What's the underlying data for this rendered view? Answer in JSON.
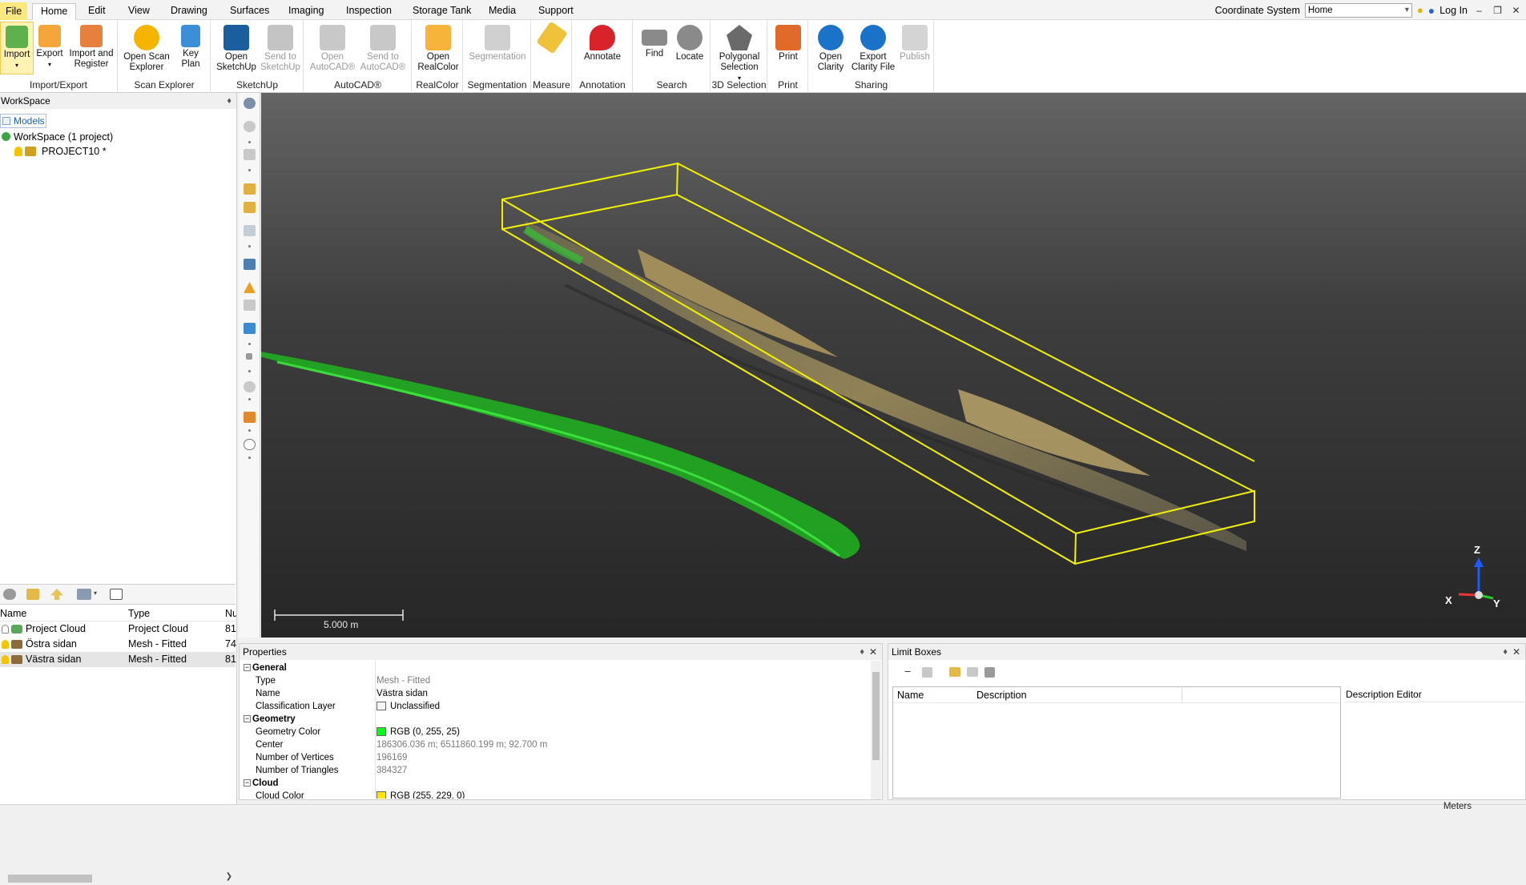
{
  "tabs": {
    "file": "File",
    "items": [
      "Home",
      "Edit",
      "View",
      "Drawing",
      "Surfaces",
      "Imaging",
      "Inspection",
      "Storage Tank",
      "Media",
      "Support"
    ]
  },
  "topright": {
    "coordinate_label": "Coordinate System",
    "coordinate_value": "Home",
    "login": "Log In"
  },
  "ribbon": {
    "groups": [
      {
        "name": "Import/Export",
        "buttons": [
          "Import",
          "Export",
          "Import and Register"
        ]
      },
      {
        "name": "Scan Explorer",
        "buttons": [
          "Open Scan Explorer",
          "Key Plan"
        ]
      },
      {
        "name": "SketchUp",
        "buttons": [
          "Open SketchUp",
          "Send to SketchUp"
        ]
      },
      {
        "name": "AutoCAD®",
        "buttons": [
          "Open AutoCAD®",
          "Send to AutoCAD®"
        ]
      },
      {
        "name": "RealColor",
        "buttons": [
          "Open RealColor"
        ]
      },
      {
        "name": "Segmentation",
        "buttons": [
          "Segmentation"
        ]
      },
      {
        "name": "Measure",
        "buttons": []
      },
      {
        "name": "Annotation",
        "buttons": [
          "Annotate"
        ]
      },
      {
        "name": "Search",
        "buttons": [
          "Find",
          "Locate"
        ]
      },
      {
        "name": "3D Selection",
        "buttons": [
          "Polygonal Selection"
        ]
      },
      {
        "name": "Print",
        "buttons": [
          "Print"
        ]
      },
      {
        "name": "Sharing",
        "buttons": [
          "Open Clarity",
          "Export Clarity File",
          "Publish"
        ]
      }
    ]
  },
  "workspace": {
    "title": "WorkSpace",
    "models_tab": "Models",
    "tree": [
      "WorkSpace  (1 project)",
      "PROJECT10  *"
    ]
  },
  "objects": {
    "columns": [
      "Name",
      "Type",
      "Nu"
    ],
    "rows": [
      {
        "name": "Project Cloud",
        "type": "Project Cloud",
        "num": "81"
      },
      {
        "name": "Östra sidan",
        "type": "Mesh - Fitted",
        "num": "74"
      },
      {
        "name": "Västra sidan",
        "type": "Mesh - Fitted",
        "num": "81"
      }
    ]
  },
  "viewport": {
    "scale_label": "5.000 m",
    "axes": {
      "x": "X",
      "y": "Y",
      "z": "Z"
    }
  },
  "properties": {
    "title": "Properties",
    "rows": [
      {
        "section": "General"
      },
      {
        "key": "Type",
        "value": "Mesh - Fitted"
      },
      {
        "key": "Name",
        "value": "Västra sidan"
      },
      {
        "key": "Classification Layer",
        "value": "Unclassified",
        "swatch": "#ffffff"
      },
      {
        "section": "Geometry"
      },
      {
        "key": "Geometry Color",
        "value": "RGB (0, 255, 25)",
        "swatch": "#00ff19"
      },
      {
        "key": "Center",
        "value": "186306.036 m; 6511860.199 m; 92.700 m"
      },
      {
        "key": "Number of Vertices",
        "value": "196169"
      },
      {
        "key": "Number of Triangles",
        "value": "384327"
      },
      {
        "section": "Cloud"
      },
      {
        "key": "Cloud Color",
        "value": "RGB (255, 229, 0)",
        "swatch": "#ffe500"
      }
    ]
  },
  "limit_boxes": {
    "title": "Limit Boxes",
    "columns": [
      "Name",
      "Description"
    ],
    "description_editor": "Description Editor"
  },
  "status": {
    "units": "Meters"
  }
}
